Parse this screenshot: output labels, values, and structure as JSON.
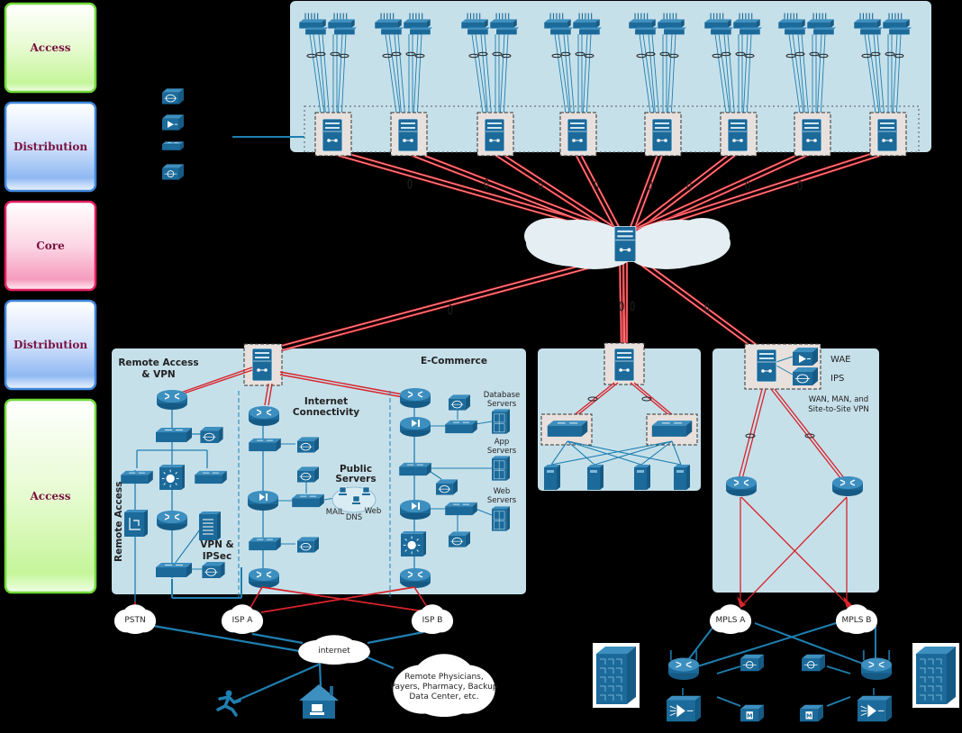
{
  "tiers": [
    {
      "label": "Access",
      "style": "green"
    },
    {
      "label": "Distribution",
      "style": "blue"
    },
    {
      "label": "Core",
      "style": "pink"
    },
    {
      "label": "Distribution",
      "style": "blue"
    },
    {
      "label": "Access",
      "style": "green"
    }
  ],
  "legend_icons": [
    "ips-icon",
    "wae-icon",
    "wireless-lan-controller-icon",
    "network-analysis-module-icon"
  ],
  "campus": {
    "building_blocks": 8,
    "access_switch_pairs_per_block": 2,
    "distribution_switches": 8
  },
  "core": {
    "cloud_label": "",
    "device": "core-switch"
  },
  "sections": {
    "remote_access": {
      "title_line1": "Remote Access",
      "title_line2": "& VPN",
      "side_label": "Remote Access",
      "vpn_label_line1": "VPN &",
      "vpn_label_line2": "IPSec"
    },
    "internet": {
      "title_line1": "Internet",
      "title_line2": "Connectivity",
      "public_servers_line1": "Public",
      "public_servers_line2": "Servers",
      "server_labels": [
        "MAIL",
        "DNS",
        "Web"
      ]
    },
    "ecommerce": {
      "title": "E-Commerce",
      "db_line1": "Database",
      "db_line2": "Servers",
      "app_line1": "App",
      "app_line2": "Servers",
      "web_line1": "Web",
      "web_line2": "Servers"
    },
    "wan": {
      "wae": "WAE",
      "ips": "IPS",
      "desc_line1": "WAN, MAN, and",
      "desc_line2": "Site-to-Site VPN"
    }
  },
  "clouds": {
    "pstn": "PSTN",
    "isp_a": "ISP A",
    "isp_b": "ISP B",
    "internet": "internet",
    "remote_line1": "Remote Physicians,",
    "remote_line2": "Payers, Pharmacy, Backup",
    "remote_line3": "Data Center, etc.",
    "mpls_a": "MPLS A",
    "mpls_b": "MPLS B"
  },
  "colors": {
    "device_blue": "#1b6a9a",
    "panel_bg": "#c6e0ea",
    "link_red": "#d8232a",
    "link_blue": "#1f7fb0",
    "tier_green": "#6fd83a",
    "tier_blue": "#3f86d8",
    "tier_pink": "#e0205f"
  }
}
